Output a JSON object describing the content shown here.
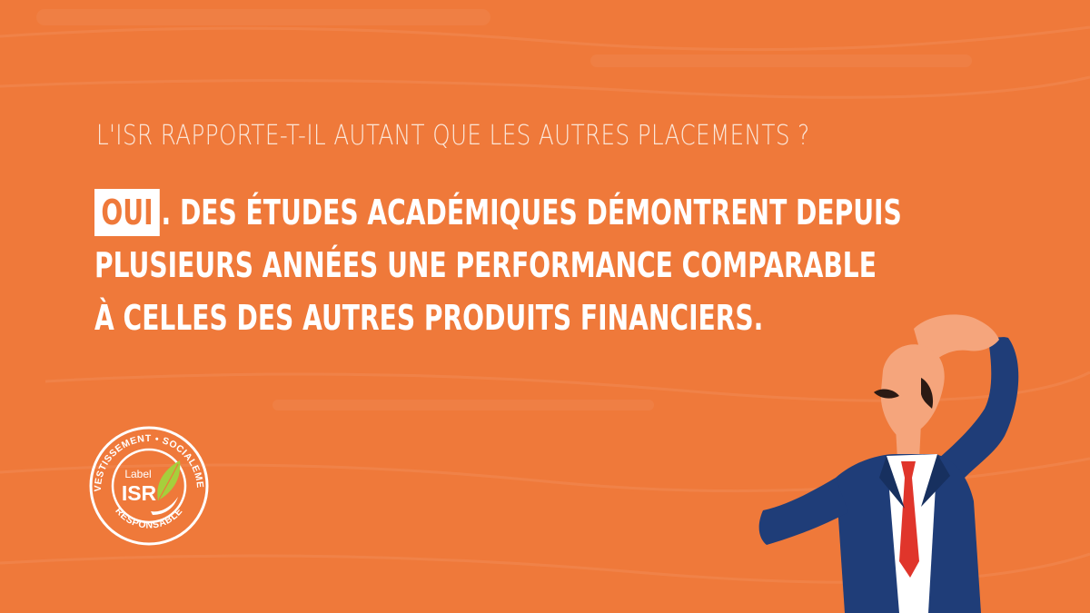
{
  "question": "L'ISR RAPPORTE-T-IL AUTANT QUE LES AUTRES PLACEMENTS ?",
  "answer": {
    "highlight": "OUI",
    "line1_rest": ". DES ÉTUDES ACADÉMIQUES DÉMONTRENT DEPUIS",
    "line2": "PLUSIEURS ANNÉES UNE PERFORMANCE COMPARABLE",
    "line3": "À CELLES DES AUTRES PRODUITS FINANCIERS."
  },
  "logo": {
    "ring_top": "INVESTISSEMENT • SOCIALEMENT",
    "ring_bottom": "RESPONSABLE",
    "label_small": "Label",
    "label_big": "ISR",
    "icon": "leaf-hand-icon"
  },
  "colors": {
    "background": "#ef793a",
    "text": "#ffffff",
    "suit": "#1f3d78",
    "tie": "#e0352b",
    "skin": "#f5a57c"
  }
}
